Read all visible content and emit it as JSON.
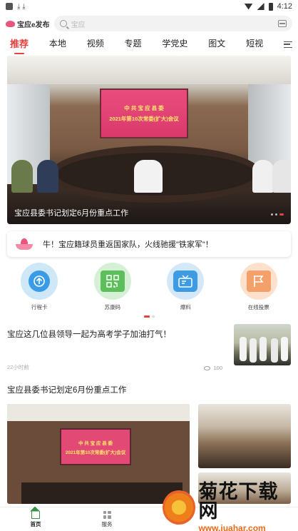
{
  "status_bar": {
    "time": "4:12",
    "download_glyphs": "⤓ ⤓"
  },
  "app": {
    "logo_text": "宝应e发布",
    "search_placeholder": "宝应"
  },
  "tabs": [
    {
      "label": "推荐",
      "active": true
    },
    {
      "label": "本地"
    },
    {
      "label": "视频"
    },
    {
      "label": "专题"
    },
    {
      "label": "学党史"
    },
    {
      "label": "图文"
    },
    {
      "label": "短视"
    }
  ],
  "hero": {
    "screen_line1": "中 共 宝 应 县 委",
    "screen_line2": "2021年第10次常委(扩大)会议",
    "caption": "宝应县委书记划定6月份重点工作"
  },
  "ticker": {
    "text": "牛！宝应籍球员重返国家队，火线驰援\"铁家军\"！"
  },
  "quick_actions": [
    {
      "label": "行程卡",
      "icon": "arrow-up-circle-icon"
    },
    {
      "label": "苏康码",
      "icon": "qr-code-icon"
    },
    {
      "label": "爆料",
      "icon": "tv-icon"
    },
    {
      "label": "在线投票",
      "icon": "vote-flag-icon"
    }
  ],
  "articles": [
    {
      "title": "宝应这几位县领导一起为高考学子加油打气！",
      "time": "22小时前",
      "views": "100"
    },
    {
      "title": "宝应县委书记划定6月份重点工作",
      "screen_line1": "中 共 宝 应 县 委",
      "screen_line2": "2021年第10次常委(扩大)会议"
    }
  ],
  "bottom_nav": [
    {
      "label": "首页",
      "active": true
    },
    {
      "label": "服务"
    }
  ],
  "watermark": {
    "text": "菊花下载网",
    "url": "www.juahar.com"
  },
  "colors": {
    "accent": "#e8403c",
    "brand_pink": "#e9557d"
  }
}
